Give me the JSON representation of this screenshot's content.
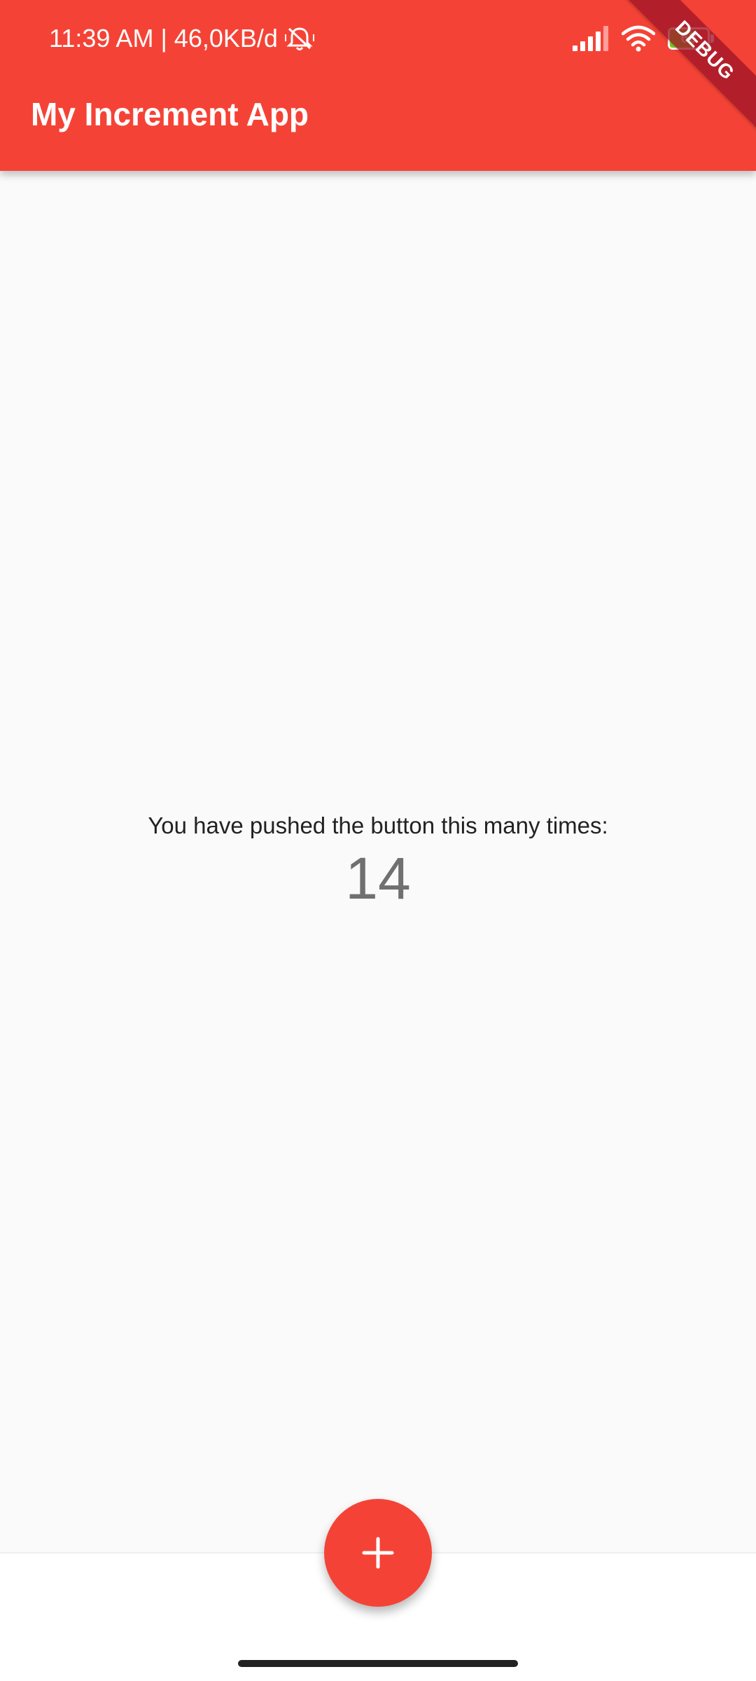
{
  "status_bar": {
    "time": "11:39 AM",
    "separator": "|",
    "network_speed": "46,0KB/d",
    "battery_level": "68",
    "icons": [
      "mute-icon",
      "signal-icon",
      "wifi-icon",
      "battery-icon"
    ]
  },
  "app_bar": {
    "title": "My Increment App",
    "color": "#f44336"
  },
  "debug_banner": {
    "label": "DEBUG"
  },
  "main": {
    "counter_label": "You have pushed the button this many times:",
    "counter_value": "14"
  },
  "fab": {
    "icon": "plus-icon",
    "color": "#f44336"
  }
}
